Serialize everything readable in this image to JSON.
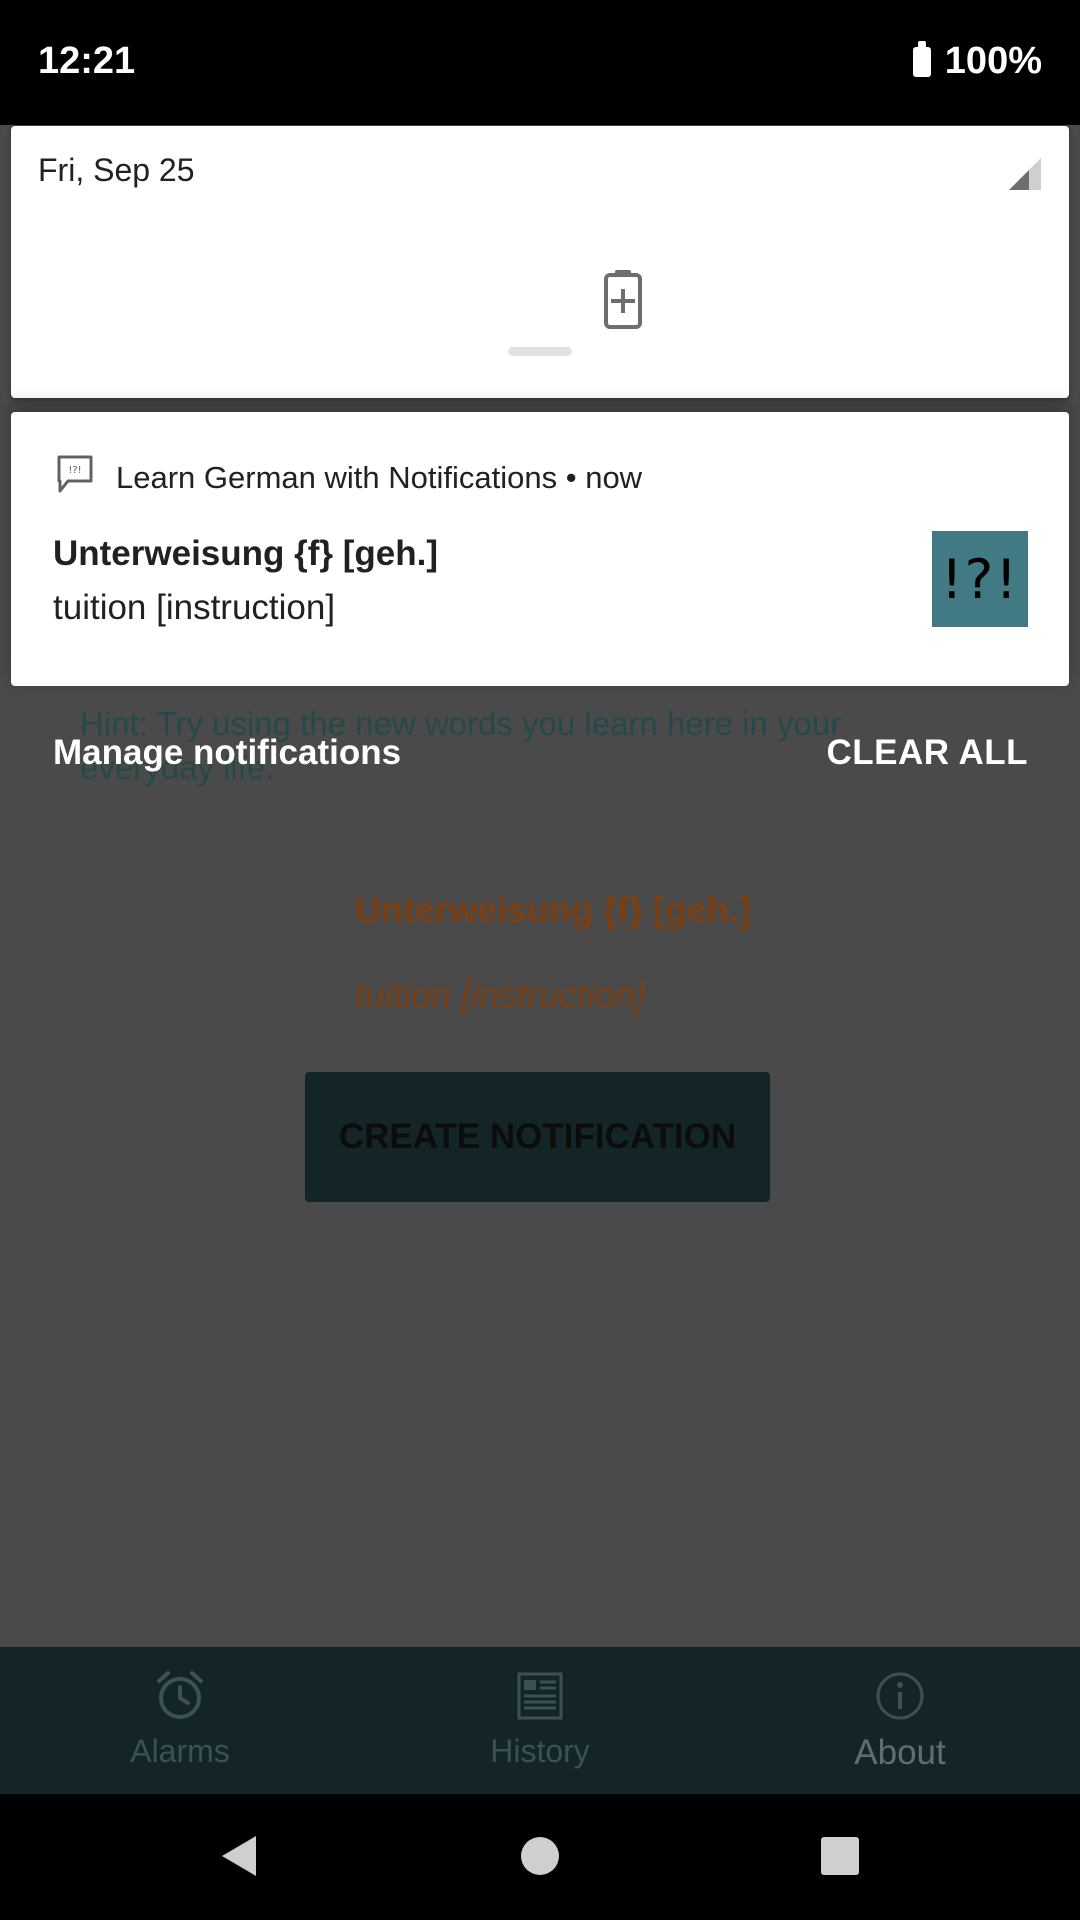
{
  "status_bar": {
    "time": "12:21",
    "battery_percent": "100%"
  },
  "quick_settings": {
    "date": "Fri, Sep 25",
    "icons": [
      "signal-icon",
      "battery-saver-icon"
    ]
  },
  "notification": {
    "app_name": "Learn German with Notifications",
    "separator": "•",
    "time": "now",
    "title": "Unterweisung {f} [geh.]",
    "text": "tuition [instruction]",
    "thumbnail_text": "!?!",
    "thumbnail_color": "#417a82"
  },
  "shade_footer": {
    "manage_label": "Manage notifications",
    "clear_all_label": "CLEAR ALL"
  },
  "app": {
    "hint": "Hint: Try using the new words you learn here in your everyday life.",
    "word": "Unterweisung {f} [geh.]",
    "translation": "tuition [instruction]",
    "create_button_label": "CREATE NOTIFICATION",
    "accent_color": "#7a3f12",
    "primary_color": "#132528"
  },
  "bottom_nav": {
    "items": [
      {
        "label": "Alarms",
        "icon": "alarm-clock-icon",
        "active": false
      },
      {
        "label": "History",
        "icon": "history-icon",
        "active": false
      },
      {
        "label": "About",
        "icon": "info-icon",
        "active": true
      }
    ]
  },
  "system_nav": {
    "buttons": [
      "back-icon",
      "home-icon",
      "recents-icon"
    ]
  }
}
